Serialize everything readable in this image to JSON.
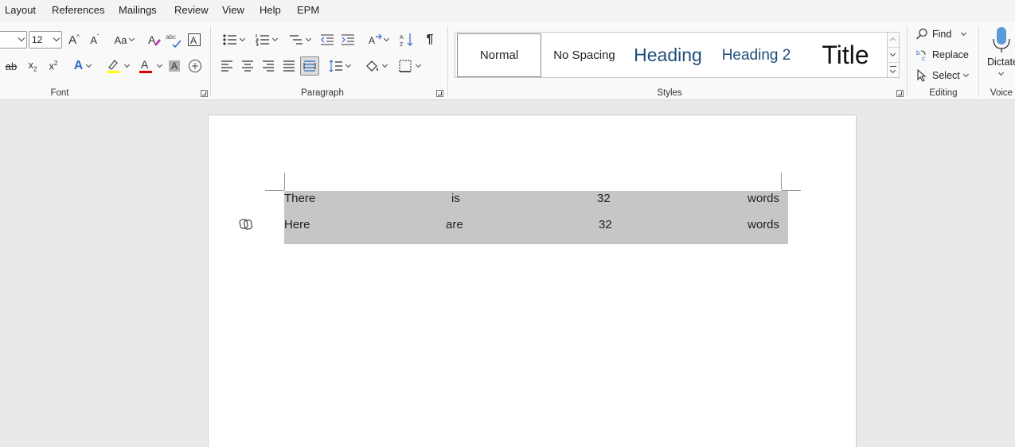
{
  "tabs": [
    "Layout",
    "References",
    "Mailings",
    "Review",
    "View",
    "Help",
    "EPM"
  ],
  "font_group": {
    "label": "Font",
    "font_size": "12",
    "grow_label": "A",
    "shrink_label": "A",
    "case_label": "Aa",
    "strike_label": "ab",
    "subscript_label": "x",
    "subscript_mark": "2",
    "superscript_label": "x",
    "superscript_mark": "2",
    "text_effect_label": "A",
    "font_color_label": "A",
    "shade_label": "A",
    "clear_label": "A",
    "abc_label": "abc",
    "highlight_color": "#ffff00",
    "font_color": "#e00000"
  },
  "paragraph_group": {
    "label": "Paragraph",
    "pilcrow": "¶"
  },
  "styles_group": {
    "label": "Styles",
    "items": [
      "Normal",
      "No Spacing",
      "Heading",
      "Heading 2",
      "Title"
    ],
    "heading_color": "#1f4e79"
  },
  "editing_group": {
    "label": "Editing",
    "find_label": "Find",
    "replace_label": "Replace",
    "select_label": "Select"
  },
  "voice_group": {
    "label": "Voice",
    "dictate_label": "Dictate"
  },
  "document": {
    "rows": [
      [
        "There",
        "is",
        "32",
        "words"
      ],
      [
        "Here",
        "are",
        "32",
        "words"
      ]
    ]
  }
}
